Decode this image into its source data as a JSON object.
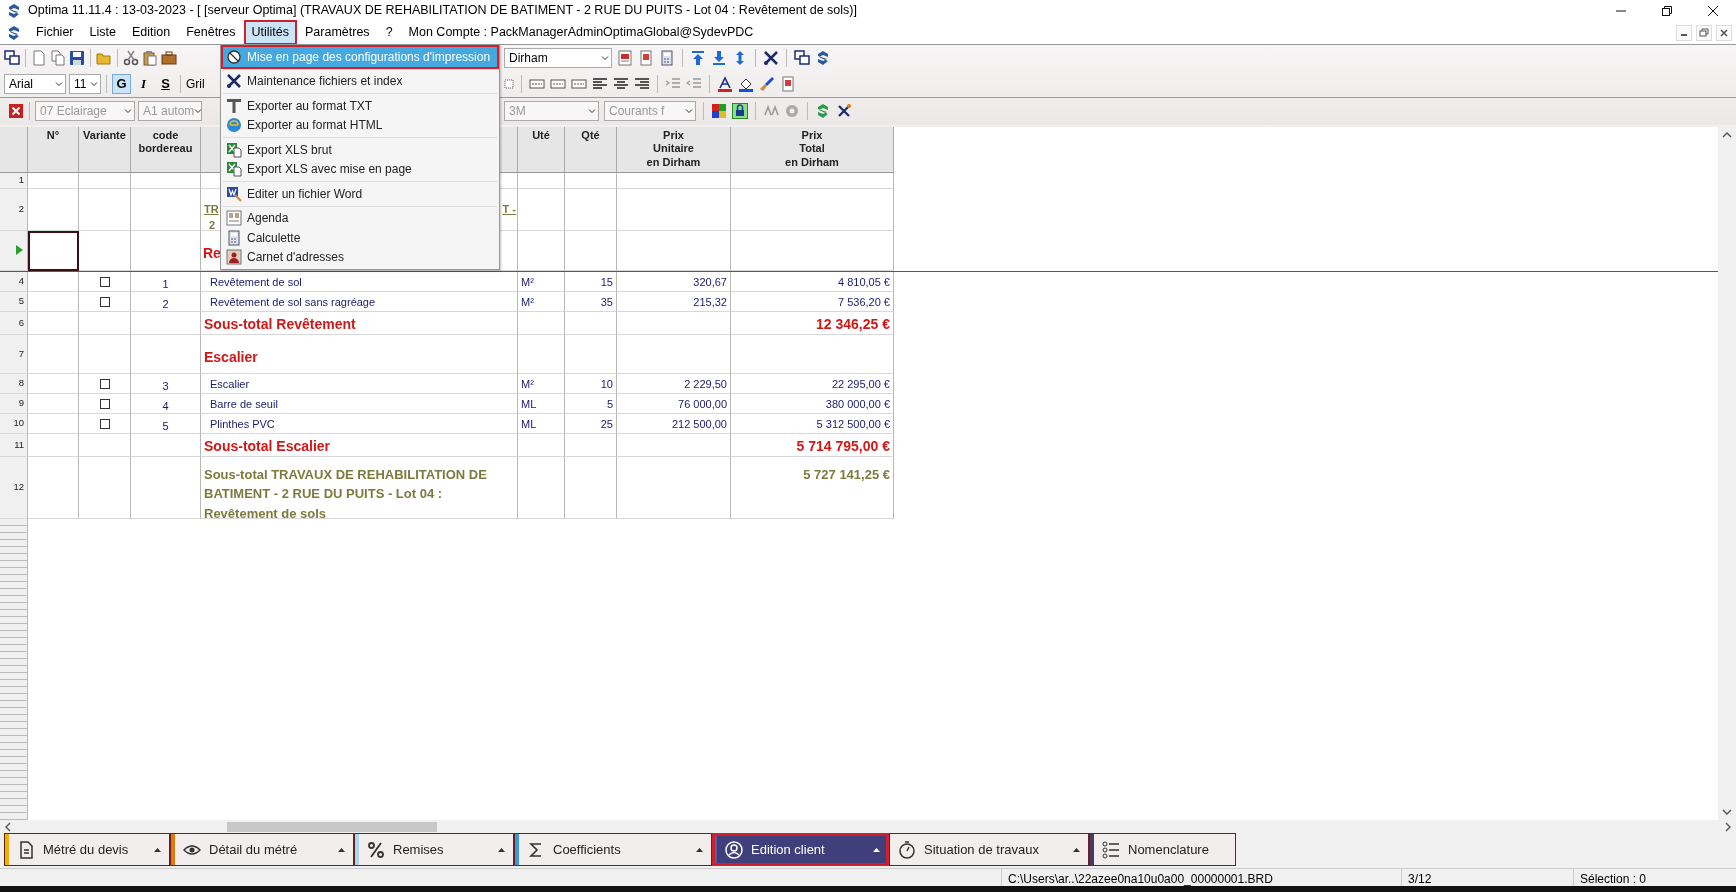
{
  "window": {
    "title": "Optima 11.11.4 : 13-03-2023 - [ [serveur Optima] (TRAVAUX DE REHABILITATION DE BATIMENT - 2 RUE DU PUITS - Lot 04 : Revêtement de sols)]"
  },
  "menu_bar": {
    "items": [
      {
        "label": "Fichier",
        "selected": false
      },
      {
        "label": "Liste",
        "selected": false
      },
      {
        "label": "Edition",
        "selected": false
      },
      {
        "label": "Fenêtres",
        "selected": false
      },
      {
        "label": "Utilités",
        "selected": true
      },
      {
        "label": "Paramètres",
        "selected": false
      },
      {
        "label": "?",
        "selected": false
      }
    ],
    "account": "Mon Compte : PackManagerAdminOptimaGlobal@SydevPDC"
  },
  "toolbar_1": {
    "currency": "Dirham"
  },
  "toolbar_2": {
    "font": "Arial",
    "size": "11",
    "styles": [
      {
        "label": "G",
        "pressed": true
      },
      {
        "label": "I",
        "pressed": false
      },
      {
        "label": "S",
        "pressed": false
      }
    ],
    "partial_label": "Gril"
  },
  "toolbar_3": {
    "fields": [
      {
        "value": "07  Eclairage",
        "disabled": true
      },
      {
        "value": "A1  autom",
        "disabled": true
      },
      {
        "value": "3M",
        "disabled": true
      },
      {
        "value": "Courants f",
        "disabled": true
      }
    ]
  },
  "dropdown_menu": {
    "groups": [
      [
        {
          "label": "Mise en page des configurations d'impression",
          "selected": true
        }
      ],
      [
        {
          "label": "Maintenance fichiers et index",
          "selected": false
        }
      ],
      [
        {
          "label": "Exporter au format TXT",
          "selected": false
        },
        {
          "label": "Exporter au format HTML",
          "selected": false
        }
      ],
      [
        {
          "label": "Export XLS brut",
          "selected": false
        },
        {
          "label": "Export XLS avec mise en page",
          "selected": false
        }
      ],
      [
        {
          "label": "Editer un fichier Word",
          "selected": false
        }
      ],
      [
        {
          "label": "Agenda",
          "selected": false
        },
        {
          "label": "Calculette",
          "selected": false
        },
        {
          "label": "Carnet d'adresses",
          "selected": false
        }
      ]
    ]
  },
  "table": {
    "columns": {
      "number": [
        "N°"
      ],
      "variant": [
        "Variante"
      ],
      "code": [
        "code",
        "bordereau"
      ],
      "unit": [
        "Uté"
      ],
      "quantity": [
        "Qté"
      ],
      "unit_price": [
        "Prix",
        "Unitaire",
        "en Dirham"
      ],
      "total_price": [
        "Prix",
        "Total",
        "en Dirham"
      ]
    },
    "rows": [
      {
        "number": "1",
        "kind": "blank",
        "current": false
      },
      {
        "number": "2",
        "kind": "title",
        "current": false,
        "left": "TR",
        "right": "T -",
        "second_line": "2"
      },
      {
        "kind": "section_partial",
        "current": true,
        "text": "Re"
      },
      {
        "number": "4",
        "kind": "item",
        "current": false,
        "checked": false,
        "code": "1",
        "designation": "Revêtement de sol",
        "unit": "M²",
        "quantity": "15",
        "unit_price": "320,67",
        "total": "4 810,05 €"
      },
      {
        "number": "5",
        "kind": "item",
        "current": false,
        "checked": false,
        "code": "2",
        "designation": "Revêtement de sol sans ragréage",
        "unit": "M²",
        "quantity": "35",
        "unit_price": "215,32",
        "total": "7 536,20 €"
      },
      {
        "number": "6",
        "kind": "subtotal",
        "current": false,
        "designation": "Sous-total Revêtement",
        "total": "12 346,25 €"
      },
      {
        "number": "7",
        "kind": "section",
        "current": false,
        "designation": "Escalier"
      },
      {
        "number": "8",
        "kind": "item",
        "current": false,
        "checked": false,
        "code": "3",
        "designation": "Escalier",
        "unit": "M²",
        "quantity": "10",
        "unit_price": "2 229,50",
        "total": "22 295,00 €"
      },
      {
        "number": "9",
        "kind": "item",
        "current": false,
        "checked": false,
        "code": "4",
        "designation": "Barre de seuil",
        "unit": "ML",
        "quantity": "5",
        "unit_price": "76 000,00",
        "total": "380 000,00 €"
      },
      {
        "number": "10",
        "kind": "item",
        "current": false,
        "checked": false,
        "code": "5",
        "designation": "Plinthes PVC",
        "unit": "ML",
        "quantity": "25",
        "unit_price": "212 500,00",
        "total": "5 312 500,00 €"
      },
      {
        "number": "11",
        "kind": "subtotal",
        "current": false,
        "designation": "Sous-total Escalier",
        "total": "5 714 795,00 €"
      },
      {
        "number": "12",
        "kind": "grand_total",
        "current": false,
        "designation": "Sous-total TRAVAUX DE REHABILITATION DE BATIMENT - 2 RUE DU PUITS  - Lot 04 : Revêtement de sols",
        "total": "5 727 141,25 €"
      }
    ]
  },
  "bottom_tabs": [
    {
      "label": "Métré du devis",
      "color": "#f0b000",
      "selected": false,
      "dropdown": true
    },
    {
      "label": "Détail du métré",
      "color": "#e07a10",
      "selected": false,
      "dropdown": true
    },
    {
      "label": "Remises",
      "color": "#a8d8f0",
      "selected": false,
      "dropdown": true
    },
    {
      "label": "Coefficients",
      "color": "#3a9ad8",
      "selected": false,
      "dropdown": true
    },
    {
      "label": "Edition client",
      "color": "#5a5aa8",
      "selected": true,
      "dropdown": true
    },
    {
      "label": "Situation de travaux",
      "selected": false,
      "dropdown": true
    },
    {
      "label": "Nomenclature",
      "color": "#4a3a6a",
      "selected": false,
      "dropdown": false
    }
  ],
  "status_bar": [
    "C:\\Users\\ar..\\22azee0na10u0a00_00000001.BRD",
    "3/12",
    "Sélection : 0"
  ]
}
